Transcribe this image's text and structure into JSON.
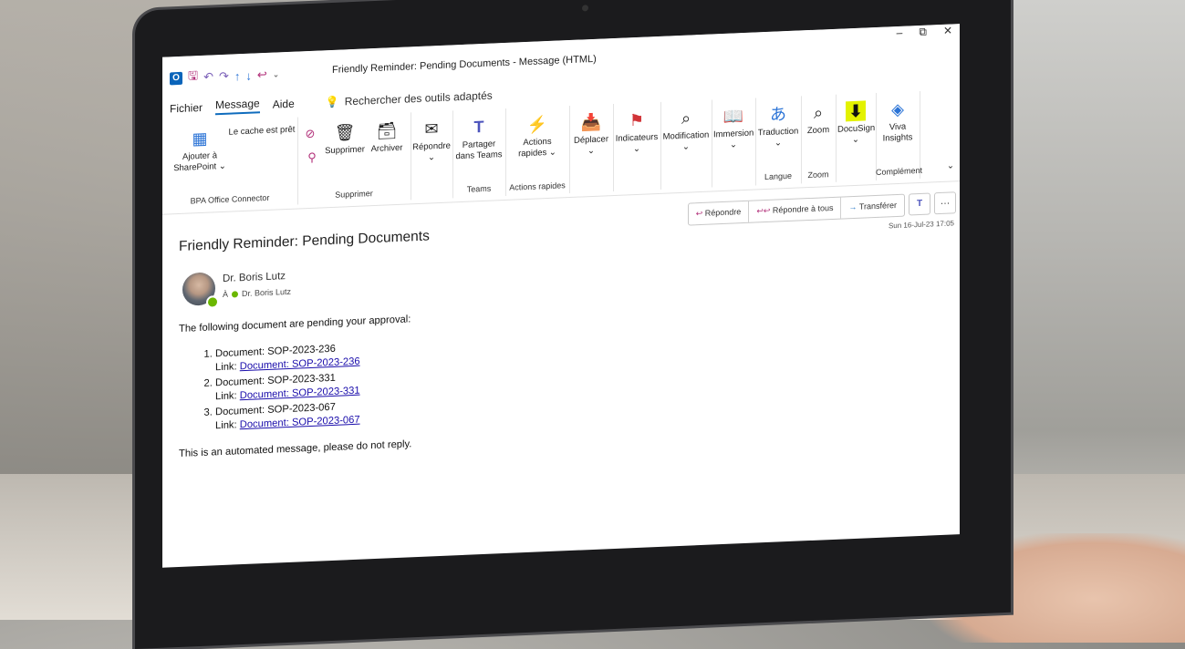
{
  "window": {
    "title": "Friendly Reminder: Pending Documents  -  Message (HTML)",
    "minimize": "–",
    "restore": "⧉",
    "close": "✕"
  },
  "menu": {
    "tabs": [
      "Fichier",
      "Message",
      "Aide"
    ],
    "active_tab": "Message",
    "search_placeholder": "Rechercher des outils adaptés"
  },
  "ribbon": {
    "groups": {
      "bpa": {
        "label": "BPA Office Connector",
        "add_sharepoint": "Ajouter à SharePoint",
        "cache_status": "Le cache est prêt"
      },
      "delete": {
        "label": "Supprimer",
        "delete": "Supprimer",
        "archive": "Archiver"
      },
      "respond": {
        "reply": "Répondre"
      },
      "teams": {
        "label": "Teams",
        "share": "Partager dans Teams"
      },
      "quick": {
        "label": "Actions rapides",
        "quick_actions": "Actions rapides"
      },
      "move": {
        "move": "Déplacer"
      },
      "tags": {
        "flags": "Indicateurs"
      },
      "edit": {
        "modify": "Modification"
      },
      "immersive": {
        "immersion": "Immersion"
      },
      "language": {
        "label": "Langue",
        "translate": "Traduction"
      },
      "zoom": {
        "label": "Zoom",
        "zoom": "Zoom"
      },
      "docusign": {
        "docusign": "DocuSign"
      },
      "addin": {
        "label": "Complément",
        "viva": "Viva Insights"
      }
    }
  },
  "message": {
    "subject": "Friendly Reminder: Pending Documents",
    "actions": {
      "reply": "Répondre",
      "reply_all": "Répondre à tous",
      "forward": "Transférer"
    },
    "date": "Sun 16-Jul-23 17:05",
    "sender": "Dr. Boris Lutz",
    "to_label": "À",
    "to_name": "Dr. Boris Lutz",
    "intro": "The following document are pending your approval:",
    "items": [
      {
        "doc": "Document: SOP-2023-236",
        "link_label": "Link:",
        "link": "Document: SOP-2023-236"
      },
      {
        "doc": "Document: SOP-2023-331",
        "link_label": "Link:",
        "link": "Document: SOP-2023-331"
      },
      {
        "doc": "Document: SOP-2023-067",
        "link_label": "Link:",
        "link": "Document: SOP-2023-067"
      }
    ],
    "footer": "This is an automated message, please do not reply."
  }
}
